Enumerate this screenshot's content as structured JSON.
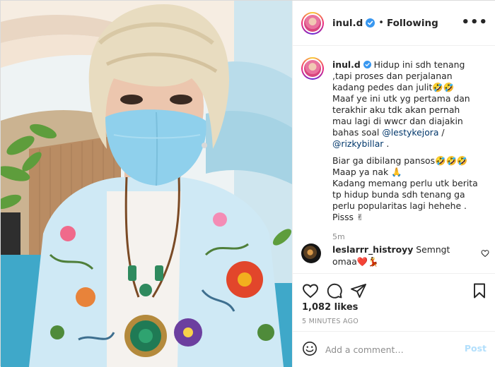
{
  "post": {
    "username": "inul.d",
    "dot": "•",
    "follow_status": "Following",
    "more_glyph": "•••"
  },
  "caption": {
    "username": "inul.d",
    "lines_1": [
      "Hidup ini sdh tenang",
      ",tapi proses dan perjalanan",
      "kadang pedes dan julit🤣🤣",
      "Maaf ye ini utk yg pertama dan",
      "terakhir aku tdk akan pernah",
      "mau lagi di wwcr dan diajakin"
    ],
    "line_7_prefix": "bahas soal ",
    "mention_1": "@lestykejora",
    "line_7_suffix": " /",
    "mention_2": "@rizkybillar",
    "line_8_suffix": " .",
    "lines_2": [
      "Biar ga dibilang pansos🤣🤣🤣",
      "Maap ya nak 🙏",
      "Kadang memang perlu utk berita",
      "tp hidup bunda sdh tenang ga",
      "perlu popularitas lagi hehehe .",
      "Pisss ✌"
    ],
    "time": "5m"
  },
  "comment": {
    "username": "leslarrr_histroyy",
    "text": "Semngt omaa❤️💃"
  },
  "actions": {
    "likes": "1,082 likes",
    "posted_ago": "5 MINUTES AGO"
  },
  "add_comment": {
    "placeholder": "Add a comment…",
    "post_label": "Post"
  },
  "icons": {
    "verified": "verified-badge-icon",
    "like": "heart-icon",
    "comment": "comment-bubble-icon",
    "share": "paper-plane-icon",
    "save": "bookmark-icon",
    "emoji": "emoji-icon",
    "more": "more-options-icon"
  },
  "colors": {
    "verified_blue": "#3897f0",
    "link_blue": "#00376b",
    "post_button_disabled": "#b2dffc",
    "secondary_text": "#8e8e8e",
    "divider": "#efefef",
    "mask": "#8fd0ec"
  }
}
